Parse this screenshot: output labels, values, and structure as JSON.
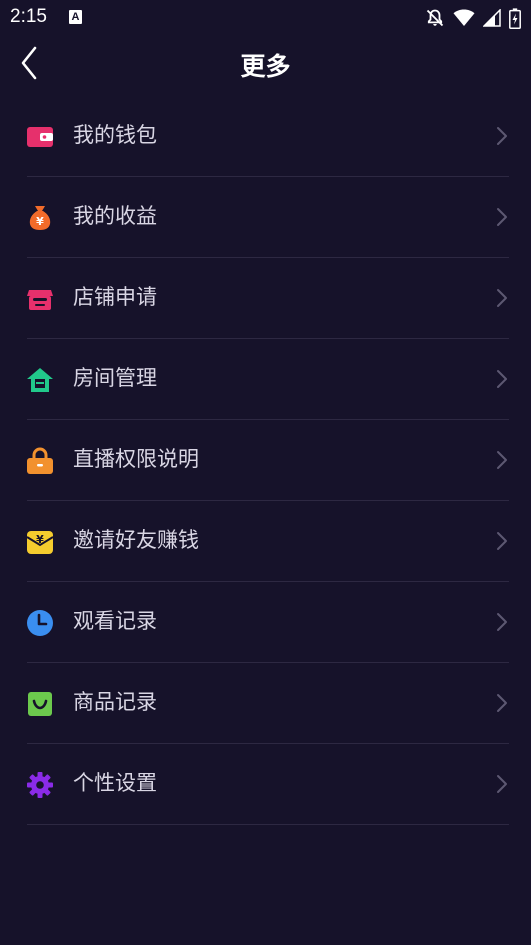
{
  "status_bar": {
    "time": "2:15",
    "notification_icon": "A"
  },
  "header": {
    "title": "更多",
    "back_icon": "chevron-left-icon"
  },
  "menu": [
    {
      "label": "我的钱包",
      "icon": "wallet-icon",
      "color": "#e6306c"
    },
    {
      "label": "我的收益",
      "icon": "money-bag-icon",
      "color": "#f26b2a"
    },
    {
      "label": "店铺申请",
      "icon": "shop-icon",
      "color": "#e6306c"
    },
    {
      "label": "房间管理",
      "icon": "house-icon",
      "color": "#21c98b"
    },
    {
      "label": "直播权限说明",
      "icon": "lock-icon",
      "color": "#f2912e"
    },
    {
      "label": "邀请好友赚钱",
      "icon": "invite-money-icon",
      "color": "#f5cc2e"
    },
    {
      "label": "观看记录",
      "icon": "clock-icon",
      "color": "#3a8ef0"
    },
    {
      "label": "商品记录",
      "icon": "shopping-bag-icon",
      "color": "#6cc94d"
    },
    {
      "label": "个性设置",
      "icon": "gear-icon",
      "color": "#8a2be8"
    }
  ],
  "colors": {
    "background": "#16122a",
    "divider": "#2d2842",
    "text": "#d9d6e4",
    "chevron": "#5d5872"
  }
}
